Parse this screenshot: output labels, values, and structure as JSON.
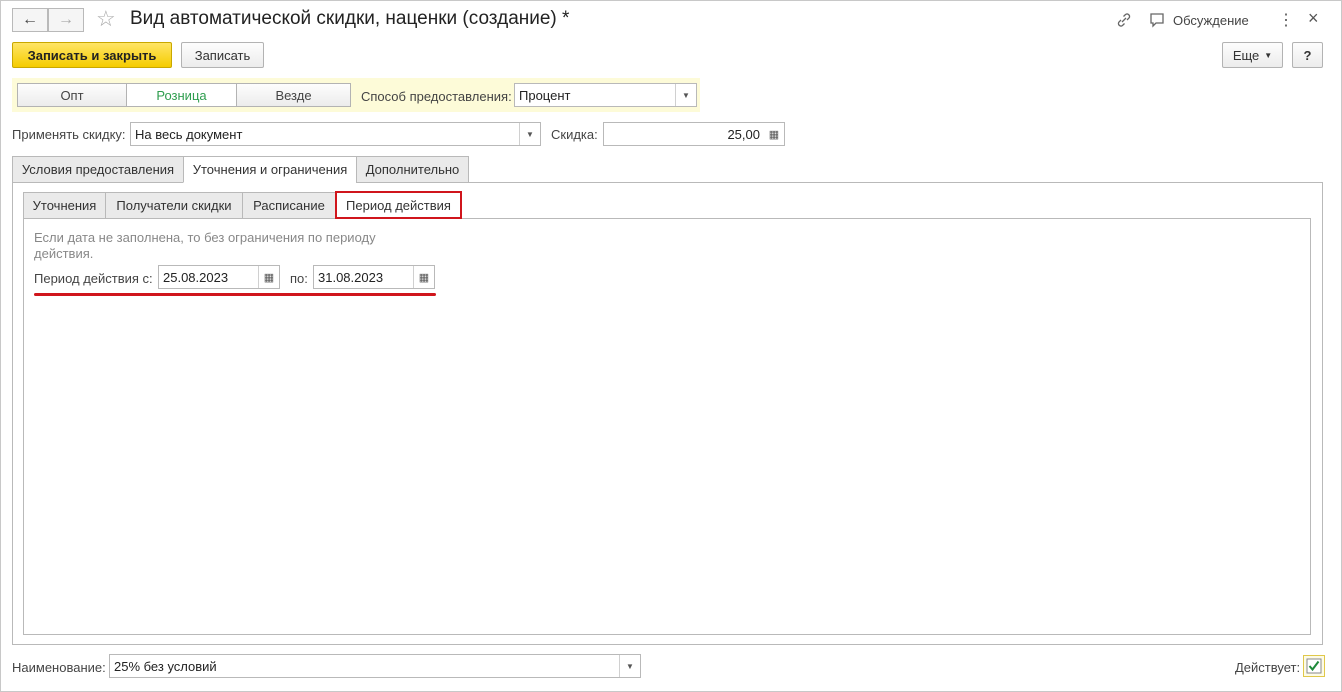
{
  "window": {
    "title": "Вид автоматической скидки, наценки (создание) *",
    "back_icon": "←",
    "forward_icon": "→",
    "favorite_icon": "☆",
    "link_icon": "🔗",
    "discussion_label": "Обсуждение",
    "more_icon": "⋮",
    "close_icon": "×"
  },
  "toolbar": {
    "save_close_label": "Записать и закрыть",
    "save_label": "Записать",
    "more_label": "Еще",
    "help_label": "?"
  },
  "segments": {
    "items": [
      "Опт",
      "Розница",
      "Везде"
    ],
    "selected": "Розница"
  },
  "method": {
    "label": "Способ предоставления:",
    "value": "Процент"
  },
  "apply": {
    "label": "Применять скидку:",
    "value": "На весь документ"
  },
  "discount": {
    "label": "Скидка:",
    "value": "25,00"
  },
  "main_tabs": [
    "Условия предоставления",
    "Уточнения и ограничения",
    "Дополнительно"
  ],
  "sub_tabs": [
    "Уточнения",
    "Получатели скидки",
    "Расписание",
    "Период действия"
  ],
  "period": {
    "hint": "Если дата не заполнена, то без ограничения по периоду действия.",
    "from_label": "Период действия с:",
    "from_value": "25.08.2023",
    "to_label": "по:",
    "to_value": "31.08.2023"
  },
  "name": {
    "label": "Наименование:",
    "value": "25% без условий"
  },
  "active": {
    "label": "Действует:",
    "checked": true
  },
  "colors": {
    "accent_yellow": "#f5cc00",
    "highlight_red": "#d0151c",
    "selected_green": "#2e9d4e"
  }
}
